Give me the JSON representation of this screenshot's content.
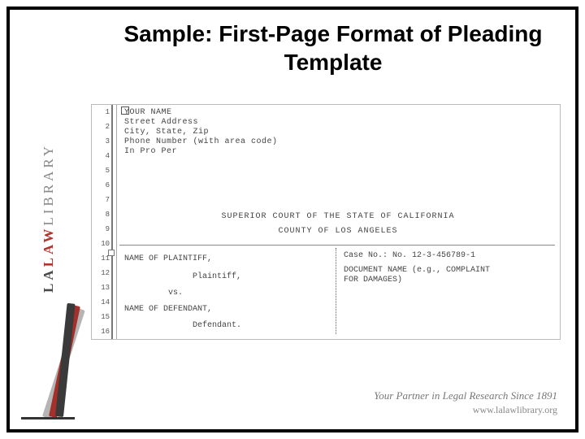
{
  "title": "Sample: First-Page Format of Pleading Template",
  "pleading": {
    "line_numbers": [
      "1",
      "2",
      "3",
      "4",
      "5",
      "6",
      "7",
      "8",
      "9",
      "10",
      "11",
      "12",
      "13",
      "14",
      "15",
      "16"
    ],
    "caption_top": {
      "name": "YOUR NAME",
      "street": "Street Address",
      "city_state_zip": "City,  State,  Zip",
      "phone": "Phone Number (with area code)",
      "pro_per": "In Pro Per"
    },
    "court_line1": "SUPERIOR COURT OF THE STATE OF CALIFORNIA",
    "court_line2": "COUNTY OF LOS ANGELES",
    "caption_box": {
      "plaintiff_name": "NAME OF PLAINTIFF,",
      "plaintiff_role": "Plaintiff,",
      "vs": "vs.",
      "defendant_name": "NAME OF DEFENDANT,",
      "defendant_role": "Defendant.",
      "case_no": "Case No.: No. 12-3-456789-1",
      "doc_name_l1": "DOCUMENT NAME (e.g., COMPLAINT",
      "doc_name_l2": "FOR DAMAGES)"
    }
  },
  "brand": {
    "la": "LA",
    "law": "LAW",
    "library": "LIBRARY"
  },
  "footer": {
    "tagline": "Your Partner in Legal Research Since 1891",
    "url": "www.lalawlibrary.org"
  }
}
